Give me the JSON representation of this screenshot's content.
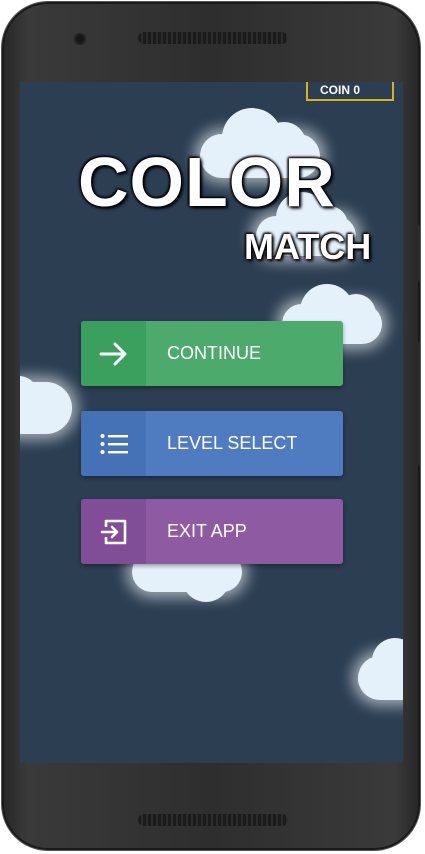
{
  "status": {
    "coin_label": "COIN 0"
  },
  "title": {
    "line1": "COLOR",
    "line2": "MATCH"
  },
  "menu": {
    "continue_label": "CONTINUE",
    "level_select_label": "LEVEL SELECT",
    "exit_label": "EXIT APP"
  },
  "icons": {
    "continue": "arrow-right-icon",
    "level_select": "list-icon",
    "exit": "exit-icon"
  },
  "colors": {
    "background": "#2b3e52",
    "continue": "#4caa6c",
    "level_select": "#4f7cc1",
    "exit": "#8e5aa2",
    "coin_border": "#d9b21f"
  }
}
